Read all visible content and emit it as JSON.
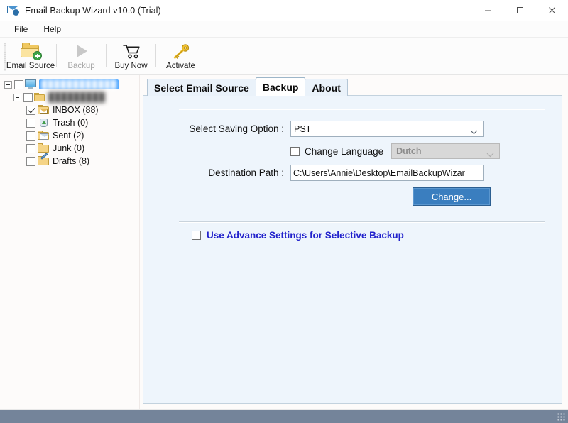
{
  "window": {
    "title": "Email Backup Wizard v10.0 (Trial)",
    "app_icon": "email-app-icon",
    "minimize": "minimize-icon",
    "maximize": "maximize-icon",
    "close": "close-icon"
  },
  "menubar": {
    "items": [
      {
        "label": "File"
      },
      {
        "label": "Help"
      }
    ]
  },
  "toolbar": {
    "items": [
      {
        "label": "Email Source",
        "icon": "folder-add-icon",
        "disabled": false
      },
      {
        "label": "Backup",
        "icon": "play-icon",
        "disabled": true
      },
      {
        "label": "Buy Now",
        "icon": "shopping-cart-icon",
        "disabled": false
      },
      {
        "label": "Activate",
        "icon": "key-icon",
        "disabled": false
      }
    ]
  },
  "tree": {
    "root": {
      "label": "████████████",
      "icon": "computer-icon",
      "selected": true,
      "checked": false,
      "expanded": true
    },
    "account": {
      "label": "█████████",
      "icon": "folder-icon",
      "checked": false,
      "expanded": true
    },
    "folders": [
      {
        "label": "INBOX (88)",
        "icon": "inbox-folder-icon",
        "checked": true
      },
      {
        "label": "Trash (0)",
        "icon": "trash-folder-icon",
        "checked": false
      },
      {
        "label": "Sent (2)",
        "icon": "sent-folder-icon",
        "checked": false
      },
      {
        "label": "Junk (0)",
        "icon": "junk-folder-icon",
        "checked": false
      },
      {
        "label": "Drafts (8)",
        "icon": "drafts-folder-icon",
        "checked": false
      }
    ]
  },
  "tabs": [
    {
      "label": "Select Email Source",
      "active": false
    },
    {
      "label": "Backup",
      "active": true
    },
    {
      "label": "About",
      "active": false
    }
  ],
  "backup_tab": {
    "saving_option": {
      "label": "Select Saving Option :",
      "value": "PST",
      "chevron": "chevron-down-icon"
    },
    "change_language": {
      "label": "Change Language",
      "checked": false,
      "language_value": "Dutch",
      "language_disabled": true,
      "chevron": "chevron-down-icon"
    },
    "destination": {
      "label": "Destination Path :",
      "value": "C:\\Users\\Annie\\Desktop\\EmailBackupWizar",
      "placeholder": "Destination Path"
    },
    "change_button": {
      "label": "Change..."
    },
    "advance_settings": {
      "label": "Use Advance Settings for Selective Backup",
      "checked": false
    }
  },
  "colors": {
    "accent_blue": "#3a7ebf",
    "link_blue": "#2222cc",
    "statusbar": "#74849a",
    "panel_bg": "#eef5fc",
    "selection": "#3399ff"
  },
  "statusbar": {
    "text": "",
    "grip": "resize-grip-icon"
  }
}
